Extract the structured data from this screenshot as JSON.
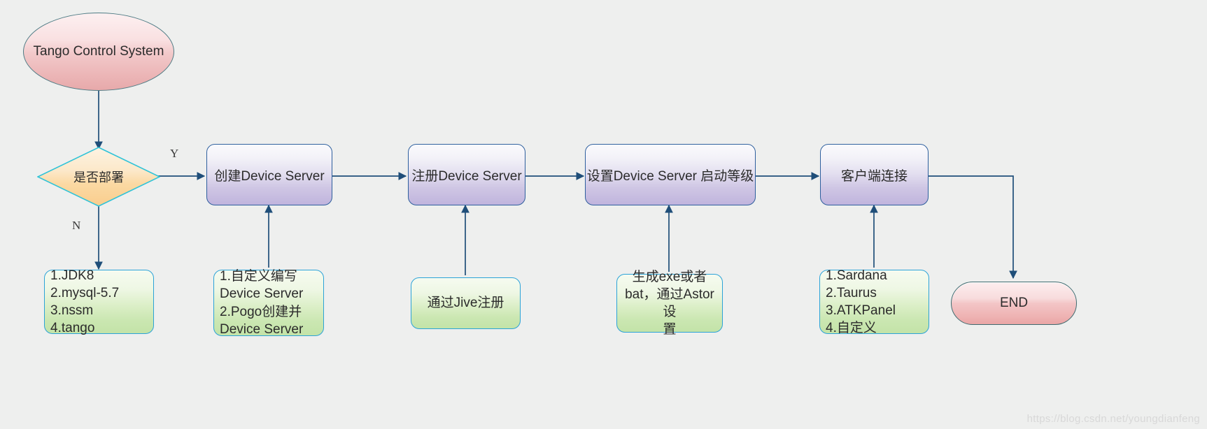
{
  "diagram": {
    "title": "Tango Control System deployment flowchart",
    "colors": {
      "background": "#eeefee",
      "edge": "#1f4e79",
      "terminator_fill": "#f2c6c7",
      "process_fill": "#cfc6e4",
      "note_fill": "#cbe7b2",
      "decision_fill": "#fbd9a1"
    },
    "nodes": {
      "start": {
        "label": "Tango Control System"
      },
      "decision": {
        "label": "是否部署"
      },
      "prereq": {
        "label": "1.JDK8\n2.mysql-5.7\n3.nssm\n4.tango"
      },
      "create_ds": {
        "label": "创建Device Server"
      },
      "create_ds_note": {
        "label": "1.自定义编写\nDevice Server\n2.Pogo创建并\nDevice Server"
      },
      "register_ds": {
        "label": "注册Device Server"
      },
      "register_ds_note": {
        "label": "通过Jive注册"
      },
      "startup_level": {
        "label": "设置Device Server 启动等级"
      },
      "startup_level_note": {
        "label": "生成exe或者\nbat，通过Astor设\n置"
      },
      "client_connect": {
        "label": "客户端连接"
      },
      "client_connect_note": {
        "label": "1.Sardana\n2.Taurus\n3.ATKPanel\n4.自定义"
      },
      "end": {
        "label": "END"
      }
    },
    "edge_labels": {
      "yes": "Y",
      "no": "N"
    },
    "watermark": "https://blog.csdn.net/youngdianfeng"
  }
}
